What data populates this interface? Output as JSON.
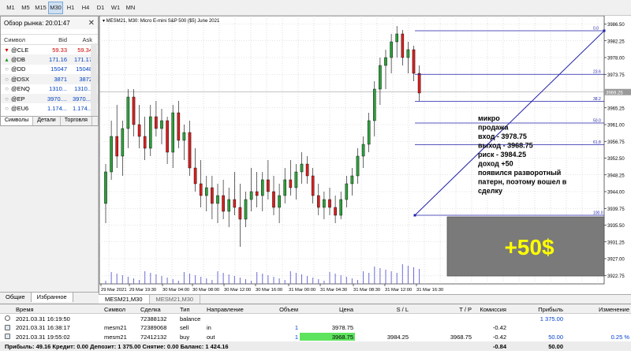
{
  "timeframes": [
    "M1",
    "M5",
    "M15",
    "M30",
    "H1",
    "H4",
    "D1",
    "W1",
    "MN"
  ],
  "active_timeframe": "M30",
  "market_watch": {
    "title": "Обзор рынка: 20:01:47",
    "columns": [
      "Символ",
      "Bid",
      "Ask"
    ],
    "rows": [
      {
        "symbol": "@CLE",
        "bid": "59.33",
        "ask": "59.34",
        "icon": "down-arrow-icon",
        "color": "red"
      },
      {
        "symbol": "@DB",
        "bid": "171.16",
        "ask": "171.17",
        "icon": "up-arrow-icon",
        "color": "blue"
      },
      {
        "symbol": "@DD",
        "bid": "15047",
        "ask": "15048",
        "icon": "circle-icon",
        "color": "blue"
      },
      {
        "symbol": "@DSX",
        "bid": "3871",
        "ask": "3872",
        "icon": "circle-icon",
        "color": "blue"
      },
      {
        "symbol": "@ENQ",
        "bid": "1310...",
        "ask": "1310...",
        "icon": "circle-icon",
        "color": "blue"
      },
      {
        "symbol": "@EP",
        "bid": "3970....",
        "ask": "3970....",
        "icon": "circle-icon",
        "color": "blue"
      },
      {
        "symbol": "@EU6",
        "bid": "1.174...",
        "ask": "1.174...",
        "icon": "circle-icon",
        "color": "blue"
      }
    ],
    "tabs": [
      "Символы",
      "Детали",
      "Торговля"
    ]
  },
  "navigator_tabs": [
    "Общие",
    "Избранное"
  ],
  "chart": {
    "header": "MESM21, M30: Micro E-mini S&P 500 ($5) June 2021",
    "tabs": [
      "MESM21,M30",
      "MESM21,M30"
    ],
    "price_labels": [
      "3986.50",
      "3982.25",
      "3978.00",
      "3973.75",
      "3969.25",
      "3965.25",
      "3961.00",
      "3956.75",
      "3952.50",
      "3948.25",
      "3944.00",
      "3939.75",
      "3935.50",
      "3931.25",
      "3927.00",
      "3922.75"
    ],
    "current_price": "3969.25",
    "time_labels": [
      "29 Mar 2021",
      "29 Mar 19:30",
      "30 Mar 04:00",
      "30 Mar 08:00",
      "30 Mar 12:00",
      "30 Mar 16:00",
      "31 Mar 00:00",
      "31 Mar 04:30",
      "31 Mar 08:30",
      "31 Mar 12:00",
      "31 Mar 16:30"
    ],
    "fib_levels": [
      "0.0",
      "23.6",
      "38.2",
      "50.0",
      "61.8",
      "100.0"
    ],
    "annotation": [
      "микро",
      "продажа",
      "вход - 3978.75",
      "выход - 3968.75",
      "риск - 3984.25",
      "доход +50",
      "появился разворотный",
      "патерн, поэтому вошел в",
      "сделку"
    ],
    "profit_banner": "+50$",
    "candle_up_color": "#2e9e3a",
    "candle_down_color": "#d42020"
  },
  "terminal": {
    "columns": [
      "Время",
      "Символ",
      "Сделка",
      "Тип",
      "Направление",
      "Объем",
      "Цена",
      "S / L",
      "T / P",
      "Комиссия",
      "Прибыль",
      "Изменение"
    ],
    "rows": [
      {
        "time": "2021.03.31 16:19:50",
        "symbol": "",
        "deal": "72388132",
        "type": "balance",
        "direction": "",
        "volume": "",
        "price": "",
        "sl": "",
        "tp": "",
        "commission": "",
        "profit": "1 375.00",
        "change": ""
      },
      {
        "time": "2021.03.31 16:38:17",
        "symbol": "mesm21",
        "deal": "72389068",
        "type": "sell",
        "direction": "in",
        "volume": "1",
        "price": "3978.75",
        "sl": "",
        "tp": "",
        "commission": "-0.42",
        "profit": "",
        "change": ""
      },
      {
        "time": "2021.03.31 19:55:02",
        "symbol": "mesm21",
        "deal": "72412132",
        "type": "buy",
        "direction": "out",
        "volume": "1",
        "price": "3968.75",
        "sl": "3984.25",
        "tp": "3968.75",
        "commission": "-0.42",
        "profit": "50.00",
        "change": "0.25 %"
      }
    ],
    "summary": "Прибыль: 49.16  Кредит: 0.00  Депозит: 1 375.00  Снятие: 0.00  Баланс: 1 424.16",
    "summary_commission": "-0.84",
    "summary_profit": "50.00"
  }
}
